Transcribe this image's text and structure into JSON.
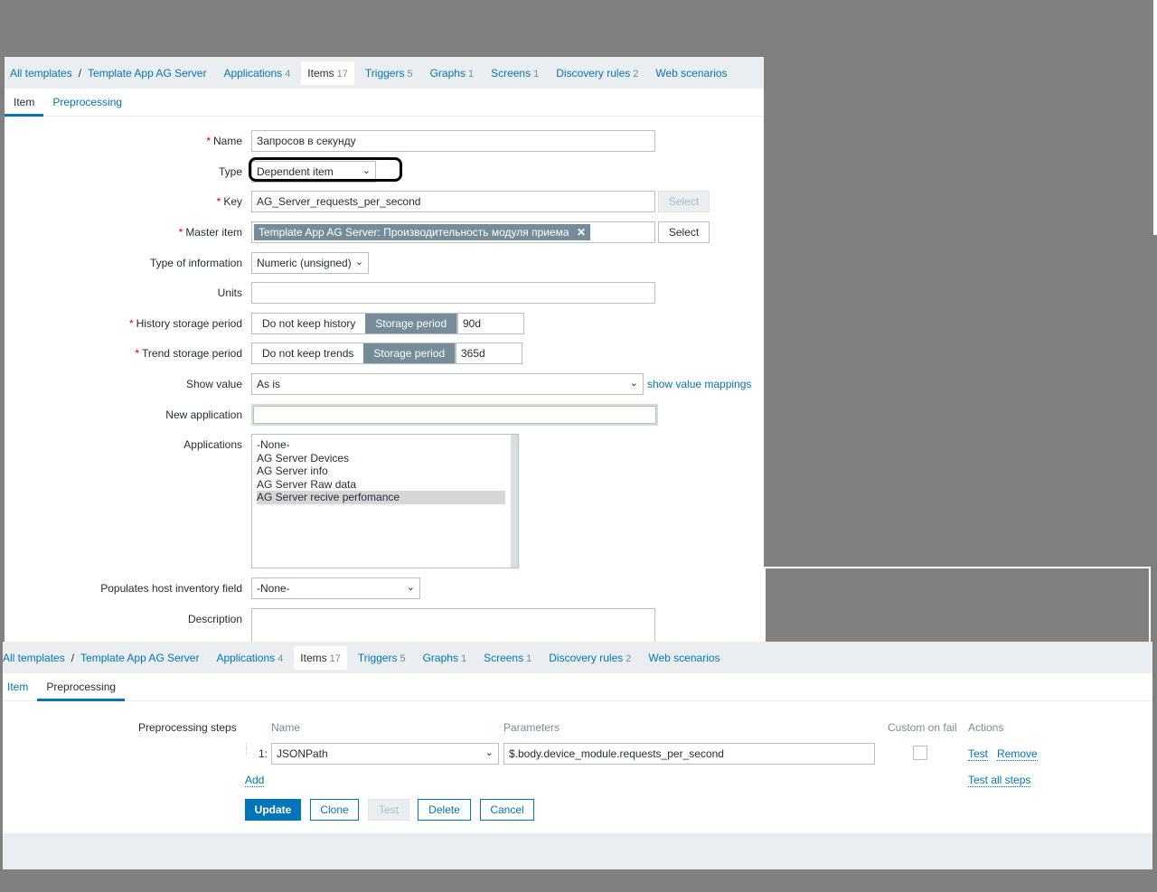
{
  "nav": {
    "all_templates": "All templates",
    "template": "Template App AG Server",
    "applications": "Applications",
    "applications_count": "4",
    "items": "Items",
    "items_count": "17",
    "triggers": "Triggers",
    "triggers_count": "5",
    "graphs": "Graphs",
    "graphs_count": "1",
    "screens": "Screens",
    "screens_count": "1",
    "discovery": "Discovery rules",
    "discovery_count": "2",
    "web": "Web scenarios"
  },
  "tabs": {
    "item": "Item",
    "preprocessing": "Preprocessing"
  },
  "form": {
    "name_label": "Name",
    "name_value": "Запросов в секунду",
    "type_label": "Type",
    "type_value": "Dependent item",
    "key_label": "Key",
    "key_value": "AG_Server_requests_per_second",
    "key_select": "Select",
    "master_label": "Master item",
    "master_value": "Template App AG Server: Производительность модуля приема",
    "master_select": "Select",
    "toi_label": "Type of information",
    "toi_value": "Numeric (unsigned)",
    "units_label": "Units",
    "units_value": "",
    "history_label": "History storage period",
    "history_opt1": "Do not keep history",
    "history_opt2": "Storage period",
    "history_value": "90d",
    "trend_label": "Trend storage period",
    "trend_opt1": "Do not keep trends",
    "trend_opt2": "Storage period",
    "trend_value": "365d",
    "show_value_label": "Show value",
    "show_value_value": "As is",
    "show_value_mappings": "show value mappings",
    "new_app_label": "New application",
    "new_app_value": "",
    "apps_label": "Applications",
    "apps": [
      "-None-",
      "AG Server Devices",
      "AG Server info",
      "AG Server Raw data",
      "AG Server recive perfomance"
    ],
    "inventory_label": "Populates host inventory field",
    "inventory_value": "-None-",
    "description_label": "Description"
  },
  "preproc": {
    "steps_label": "Preprocessing steps",
    "col_name": "Name",
    "col_params": "Parameters",
    "col_custom": "Custom on fail",
    "col_actions": "Actions",
    "step_num": "1:",
    "step_name": "JSONPath",
    "step_param": "$.body.device_module.requests_per_second",
    "test": "Test",
    "remove": "Remove",
    "add": "Add",
    "test_all": "Test all steps"
  },
  "buttons": {
    "update": "Update",
    "clone": "Clone",
    "test": "Test",
    "delete": "Delete",
    "cancel": "Cancel"
  }
}
